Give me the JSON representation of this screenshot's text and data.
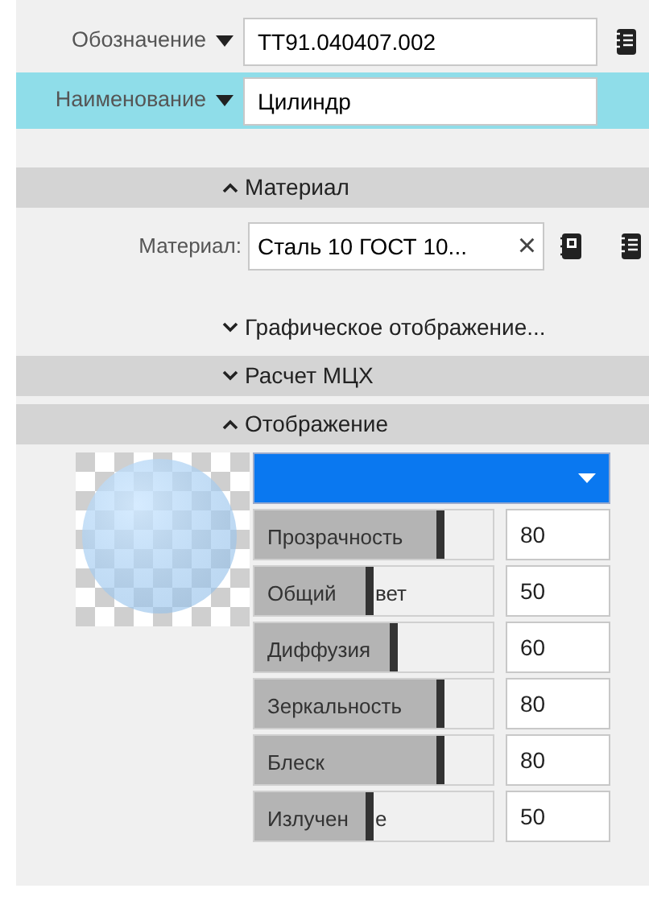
{
  "fields": [
    {
      "label": "Обозначение",
      "value": "ТТ91.040407.002",
      "selected": false
    },
    {
      "label": "Наименование",
      "value": "Цилиндр",
      "selected": true
    }
  ],
  "material_section": {
    "title": "Материал",
    "expanded": true,
    "kind": "band"
  },
  "material": {
    "label": "Материал:",
    "value": "Сталь 10  ГОСТ 10...",
    "clear": "×"
  },
  "sections": [
    {
      "title": "Графическое отображение...",
      "expanded": false,
      "kind": "plain"
    },
    {
      "title": "Расчет МЦХ",
      "expanded": false,
      "kind": "band"
    },
    {
      "title": "Отображение",
      "expanded": true,
      "kind": "band"
    }
  ],
  "color": {
    "color": "#0a78f0"
  },
  "sliders": [
    {
      "label": "Прозрачность",
      "level": 0.8,
      "value": "80"
    },
    {
      "label": "Общий",
      "label_after_thumb": "вет",
      "level": 0.5,
      "value": "50"
    },
    {
      "label": "Диффузия",
      "level": 0.6,
      "value": "60"
    },
    {
      "label": "Зеркальность",
      "level": 0.8,
      "value": "80"
    },
    {
      "label": "Блеск",
      "level": 0.8,
      "value": "80"
    },
    {
      "label": "Излучен",
      "label_after_thumb": "е",
      "level": 0.5,
      "value": "50"
    }
  ]
}
